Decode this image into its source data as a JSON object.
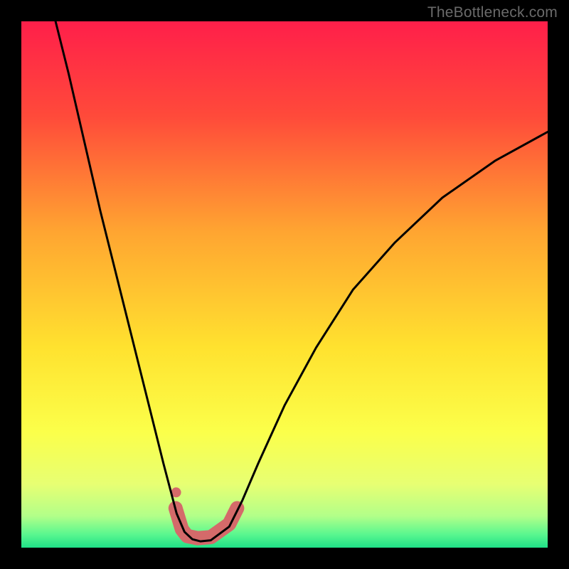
{
  "watermark": "TheBottleneck.com",
  "chart_data": {
    "type": "line",
    "title": "",
    "xlabel": "",
    "ylabel": "",
    "xlim": [
      0,
      1
    ],
    "ylim": [
      0,
      1
    ],
    "gradient_stops": [
      {
        "offset": 0.0,
        "color": "#ff1f4a"
      },
      {
        "offset": 0.18,
        "color": "#ff4a3a"
      },
      {
        "offset": 0.4,
        "color": "#ffa531"
      },
      {
        "offset": 0.62,
        "color": "#ffe22f"
      },
      {
        "offset": 0.78,
        "color": "#fbff4a"
      },
      {
        "offset": 0.88,
        "color": "#e7ff73"
      },
      {
        "offset": 0.94,
        "color": "#b2ff89"
      },
      {
        "offset": 0.975,
        "color": "#59f78f"
      },
      {
        "offset": 1.0,
        "color": "#1fe087"
      }
    ],
    "series": [
      {
        "name": "bottleneck-curve",
        "color": "#000000",
        "stroke_width": 3,
        "x": [
          0.065,
          0.09,
          0.12,
          0.15,
          0.18,
          0.21,
          0.24,
          0.27,
          0.295,
          0.31,
          0.325,
          0.34,
          0.36,
          0.395,
          0.42,
          0.45,
          0.5,
          0.56,
          0.63,
          0.71,
          0.8,
          0.9,
          1.0
        ],
        "y": [
          1.0,
          0.9,
          0.77,
          0.64,
          0.52,
          0.4,
          0.28,
          0.16,
          0.065,
          0.03,
          0.016,
          0.012,
          0.014,
          0.04,
          0.09,
          0.16,
          0.27,
          0.38,
          0.49,
          0.58,
          0.665,
          0.735,
          0.79
        ]
      },
      {
        "name": "highlight-band",
        "color": "#d46a6a",
        "stroke_width": 20,
        "x": [
          0.293,
          0.305,
          0.315,
          0.335,
          0.36,
          0.395,
          0.41
        ],
        "y": [
          0.075,
          0.035,
          0.022,
          0.018,
          0.02,
          0.045,
          0.075
        ]
      }
    ],
    "highlight_dot": {
      "x": 0.294,
      "y": 0.105,
      "r": 7,
      "color": "#d46a6a"
    }
  }
}
